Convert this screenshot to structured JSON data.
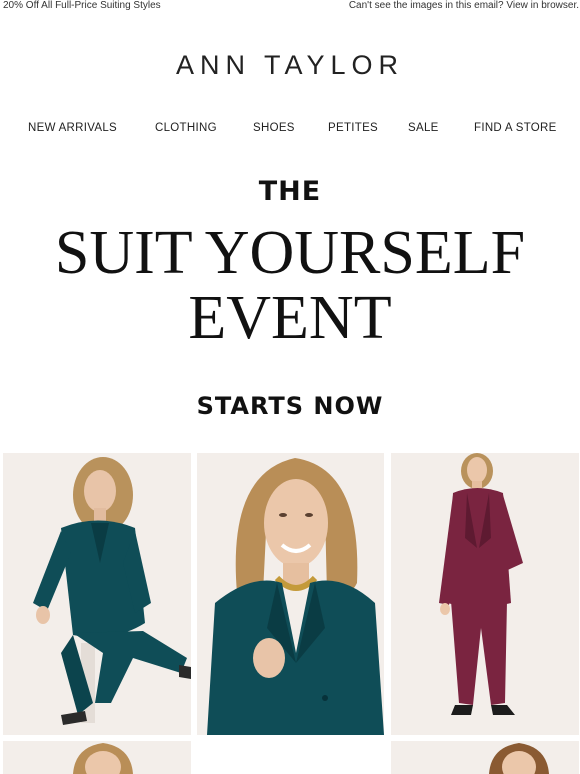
{
  "preheader": {
    "left_text": "20% Off All Full-Price Suiting Styles",
    "right_text": "Can't see the images in this email? View in browser."
  },
  "brand": {
    "logo_text": "ANN TAYLOR"
  },
  "nav": {
    "items": [
      {
        "label": "NEW ARRIVALS"
      },
      {
        "label": "CLOTHING"
      },
      {
        "label": "SHOES"
      },
      {
        "label": "PETITES"
      },
      {
        "label": "SALE"
      },
      {
        "label": "FIND A STORE"
      }
    ]
  },
  "hero": {
    "kicker": "THE",
    "headline_line1": "SUIT YOURSELF",
    "headline_line2": "EVENT",
    "subhead": "STARTS NOW"
  },
  "colors": {
    "teal_suit": "#0f4d57",
    "burgundy_suit": "#7a2440",
    "photo_bg": "#f3eeea"
  },
  "images": [
    {
      "icon": "model-seated-teal-suit"
    },
    {
      "icon": "model-closeup-teal-suit"
    },
    {
      "icon": "model-standing-burgundy-suit"
    },
    {
      "icon": "model-partial"
    },
    {
      "icon": "model-partial"
    }
  ]
}
